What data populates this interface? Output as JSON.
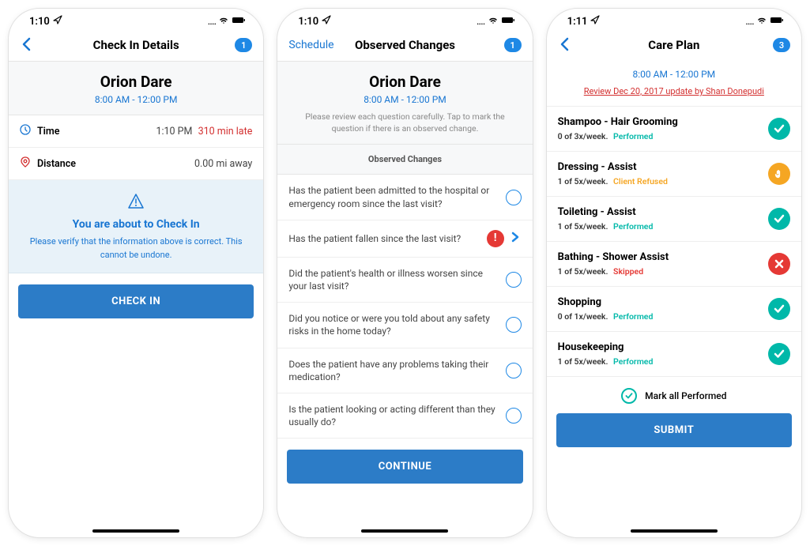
{
  "screen1": {
    "status_time": "1:10",
    "nav_title": "Check In Details",
    "badge": "1",
    "header_name": "Orion Dare",
    "header_time": "8:00 AM - 12:00 PM",
    "time_label": "Time",
    "time_value": "1:10 PM",
    "time_late": "310 min late",
    "dist_label": "Distance",
    "dist_value": "0.00 mi away",
    "info_title": "You are about to Check In",
    "info_sub": "Please verify that the information above is correct. This cannot be undone.",
    "btn": "CHECK IN"
  },
  "screen2": {
    "status_time": "1:10",
    "nav_back_text": "Schedule",
    "nav_title": "Observed Changes",
    "badge": "1",
    "header_name": "Orion Dare",
    "header_time": "8:00 AM - 12:00 PM",
    "header_sub": "Please review each question carefully. Tap to mark the question if there is an observed change.",
    "section_hdr": "Observed Changes",
    "questions": [
      {
        "text": "Has the patient been admitted to the hospital or emergency room since the last visit?",
        "state": "empty"
      },
      {
        "text": "Has the patient fallen since the last visit?",
        "state": "alert"
      },
      {
        "text": "Did the patient's health or illness worsen since your last visit?",
        "state": "empty"
      },
      {
        "text": "Did you notice or were you told about any safety risks in the home today?",
        "state": "empty"
      },
      {
        "text": "Does the patient have any problems taking their medication?",
        "state": "empty"
      },
      {
        "text": "Is the patient looking or acting different than they usually do?",
        "state": "empty"
      }
    ],
    "btn": "CONTINUE"
  },
  "screen3": {
    "status_time": "1:11",
    "nav_title": "Care Plan",
    "badge": "3",
    "header_time": "8:00 AM - 12:00 PM",
    "review_link": "Review Dec 20, 2017 update by Shan Donepudi",
    "items": [
      {
        "title": "Shampoo - Hair Grooming",
        "freq": "0 of 3x/week.",
        "status": "Performed",
        "status_class": "status-perf",
        "badge": "check",
        "badge_class": "bg-teal"
      },
      {
        "title": "Dressing - Assist",
        "freq": "1 of 5x/week.",
        "status": "Client Refused",
        "status_class": "status-refused",
        "badge": "hand",
        "badge_class": "bg-orange"
      },
      {
        "title": "Toileting - Assist",
        "freq": "1 of 5x/week.",
        "status": "Performed",
        "status_class": "status-perf",
        "badge": "check",
        "badge_class": "bg-teal"
      },
      {
        "title": "Bathing - Shower Assist",
        "freq": "1 of 5x/week.",
        "status": "Skipped",
        "status_class": "status-skip",
        "badge": "x",
        "badge_class": "bg-red"
      },
      {
        "title": "Shopping",
        "freq": "0 of 1x/week.",
        "status": "Performed",
        "status_class": "status-perf",
        "badge": "check",
        "badge_class": "bg-teal"
      },
      {
        "title": "Housekeeping",
        "freq": "1 of 5x/week.",
        "status": "Performed",
        "status_class": "status-perf",
        "badge": "check",
        "badge_class": "bg-teal"
      }
    ],
    "mark_all": "Mark all Performed",
    "btn": "SUBMIT"
  }
}
